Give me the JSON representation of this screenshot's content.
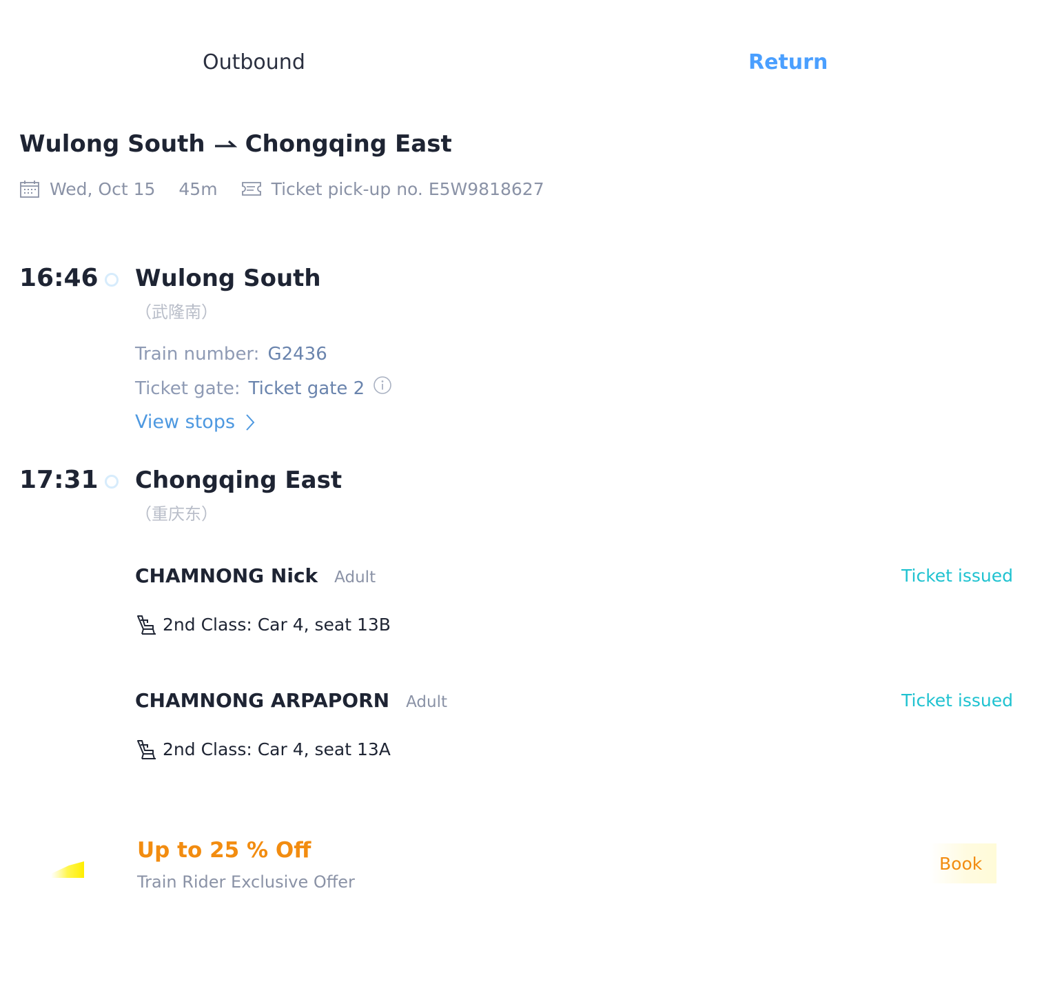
{
  "tabs": {
    "outbound_label": "Outbound",
    "return_label": "Return",
    "active": "Return"
  },
  "trip": {
    "from": "Wulong South",
    "to": "Chongqing East",
    "date": "Wed, Oct 15",
    "duration": "45m",
    "pickup_label": "Ticket pick-up no.",
    "pickup_number": "E5W9818627"
  },
  "departure": {
    "time": "16:46",
    "station": "Wulong South",
    "station_cn": "（武隆南）",
    "train_number_label": "Train number:",
    "train_number": "G2436",
    "ticket_gate_label": "Ticket gate:",
    "ticket_gate": "Ticket gate 2",
    "view_stops_label": "View stops"
  },
  "arrival": {
    "time": "17:31",
    "station": "Chongqing East",
    "station_cn": "（重庆东）"
  },
  "passengers": [
    {
      "name": "CHAMNONG Nick",
      "type": "Adult",
      "status": "Ticket issued",
      "seat": "2nd Class: Car 4, seat 13B"
    },
    {
      "name": "CHAMNONG ARPAPORN",
      "type": "Adult",
      "status": "Ticket issued",
      "seat": "2nd Class: Car 4, seat 13A"
    }
  ],
  "promo": {
    "title": "Up to 25 % Off",
    "subtitle": "Train Rider Exclusive Offer",
    "book_label": "Book"
  },
  "colors": {
    "active_tab": "#4a9fff",
    "status": "#1fc2d0",
    "promo": "#f28c10",
    "link": "#4d98e0"
  },
  "icons": [
    "calendar-icon",
    "ticket-icon",
    "arrow-right-icon",
    "info-icon",
    "chevron-right-icon",
    "seat-icon",
    "promo-icon"
  ]
}
